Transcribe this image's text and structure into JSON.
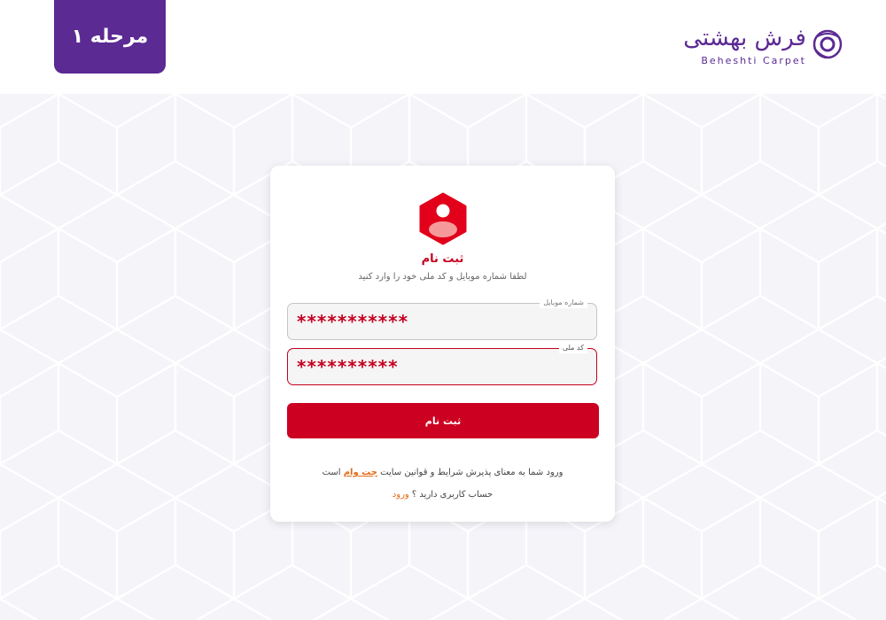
{
  "header": {
    "step_label": "مرحله ۱",
    "logo": {
      "name_fa": "فرش بهشتی",
      "name_en": "Beheshti Carpet"
    }
  },
  "form": {
    "title": "ثبت نام",
    "subtitle": "لطفا شماره موبایل و کد ملی خود را وارد کنید",
    "mobile": {
      "label": "شماره موبایل",
      "value": "***********"
    },
    "national_code": {
      "label": "کد ملی",
      "value": "**********"
    },
    "submit_label": "ثبت نام",
    "terms": {
      "before": "ورود شما به معنای پذیرش شرایط و قوانین سایت ",
      "brand": "جت وام",
      "after": " است"
    },
    "login": {
      "question": "حساب کاربری دارید ؟ ",
      "link_label": "ورود"
    }
  },
  "colors": {
    "brand_purple": "#5b2a93",
    "accent_red": "#c5001f",
    "button_red": "#cc0021",
    "link_orange": "#e66a17",
    "background": "#f4f4f9"
  },
  "icons": {
    "logo": "beheshti-carpet-logo-icon",
    "user": "user-hexagon-icon"
  }
}
